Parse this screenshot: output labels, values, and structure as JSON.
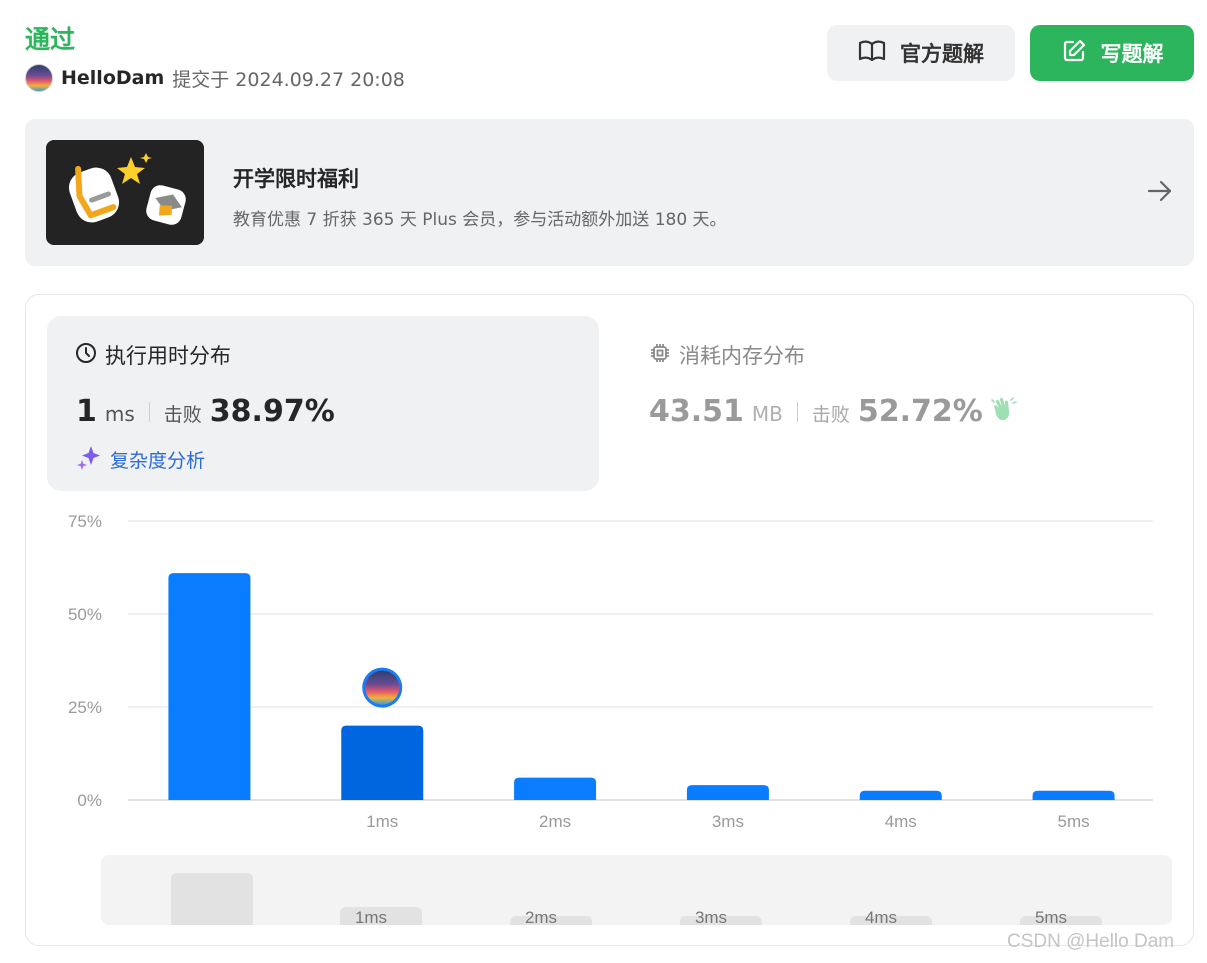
{
  "header": {
    "status": "通过",
    "username": "HelloDam",
    "submitted_label": "提交于 2024.09.27 20:08",
    "official_solution_label": "官方题解",
    "write_solution_label": "写题解"
  },
  "promo": {
    "title": "开学限时福利",
    "description": "教育优惠 7 折获 365 天 Plus 会员，参与活动额外加送 180 天。"
  },
  "runtime": {
    "title": "执行用时分布",
    "value": "1",
    "unit": "ms",
    "beat_label": "击败",
    "beat_pct": "38.97%",
    "analysis_label": "复杂度分析"
  },
  "memory": {
    "title": "消耗内存分布",
    "value": "43.51",
    "unit": "MB",
    "beat_label": "击败",
    "beat_pct": "52.72%"
  },
  "colors": {
    "accent_green": "#2db55d",
    "bar_blue": "#0a7cff",
    "bar_selected": "#0066e0",
    "link_blue": "#2a6bd8"
  },
  "chart_data": {
    "type": "bar",
    "categories": [
      "",
      "1ms",
      "2ms",
      "3ms",
      "4ms",
      "5ms"
    ],
    "values": [
      61,
      20,
      6,
      4,
      2.5,
      2.5
    ],
    "selected_index": 1,
    "yticks": [
      "0%",
      "25%",
      "50%",
      "75%"
    ],
    "ylim": [
      0,
      75
    ],
    "grid": true,
    "overview_categories": [
      "",
      "1ms",
      "2ms",
      "3ms",
      "4ms",
      "5ms"
    ]
  },
  "watermark": "CSDN @Hello Dam"
}
